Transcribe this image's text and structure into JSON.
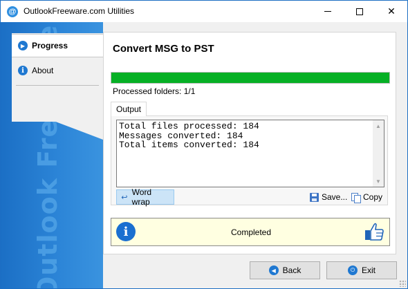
{
  "window": {
    "title": "OutlookFreeware.com Utilities"
  },
  "sidebar": {
    "brand": "Outlook Freeware.com",
    "items": [
      {
        "label": "Progress",
        "icon": "play-icon",
        "active": true
      },
      {
        "label": "About",
        "icon": "info-icon",
        "active": false
      }
    ]
  },
  "main": {
    "heading": "Convert MSG to PST",
    "progress_percent": 100,
    "processed_label": "Processed folders: 1/1",
    "tab_label": "Output",
    "output_text": "Total files processed: 184\nMessages converted: 184\nTotal items converted: 184",
    "toolbar": {
      "word_wrap_label": "Word wrap",
      "save_label": "Save...",
      "copy_label": "Copy"
    },
    "status_text": "Completed"
  },
  "footer": {
    "back_label": "Back",
    "exit_label": "Exit"
  },
  "colors": {
    "accent": "#1f78d1",
    "progress_fill": "#06b025",
    "status_bg": "#ffffe1"
  }
}
